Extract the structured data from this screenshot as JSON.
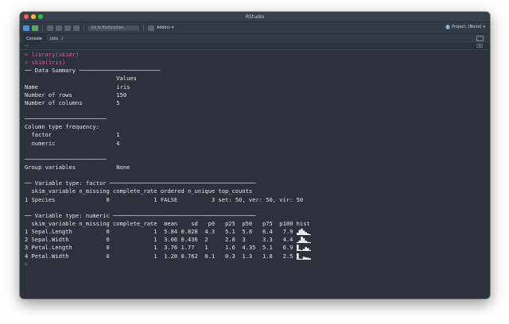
{
  "window": {
    "title": "RStudio"
  },
  "toolbar": {
    "goto_placeholder": "Go to file/function",
    "addins_label": "Addins",
    "project_label": "Project: (None)"
  },
  "tabs": [
    {
      "label": "Console",
      "active": true
    },
    {
      "label": "Jobs",
      "active": false
    }
  ],
  "subbar": {
    "path": "~/"
  },
  "colors": {
    "prompt": "#e05ca0",
    "text": "#e3e6ea",
    "background": "#2b323c"
  },
  "console": {
    "lines": [
      "> library(skimr)",
      "> skim(iris)",
      "── Data Summary ────────────────────────",
      "                           Values",
      "Name                       iris",
      "Number of rows             150",
      "Number of columns          5",
      "",
      "────────────────────────",
      "Column type frequency:",
      "  factor                   1",
      "  numeric                  4",
      "",
      "────────────────────────",
      "Group variables            None",
      "",
      "── Variable type: factor ───────────────────────────────────────────",
      "  skim_variable n_missing complete_rate ordered n_unique top_counts",
      "1 Species               0             1 FALSE          3 set: 50, ver: 50, vir: 50",
      "",
      "── Variable type: numeric ──────────────────────────────────────────",
      "  skim_variable n_missing complete_rate  mean    sd   p0   p25  p50   p75  p100 hist",
      "1 Sepal.Length          0             1  5.84 0.828  4.3   5.1  5.8   6.4   7.9 ",
      "2 Sepal.Width           0             1  3.06 0.436  2     2.8  3     3.3   4.4 ",
      "3 Petal.Length          0             1  3.76 1.77   1     1.6  4.35  5.1   6.9 ",
      "4 Petal.Width           0             1  1.20 0.762  0.1   0.3  1.3   1.8   2.5 ",
      ">"
    ],
    "prompt_line_indices": [
      0,
      1,
      26
    ],
    "histograms": {
      "22": [
        0.35,
        0.8,
        1.0,
        0.7,
        0.45,
        0.25,
        0.1
      ],
      "23": [
        0.15,
        0.4,
        1.0,
        0.75,
        0.35,
        0.15,
        0.1
      ],
      "24": [
        1.0,
        0.2,
        0.1,
        0.3,
        0.6,
        0.45,
        0.15
      ],
      "25": [
        1.0,
        0.15,
        0.1,
        0.45,
        0.35,
        0.3,
        0.2
      ]
    }
  }
}
